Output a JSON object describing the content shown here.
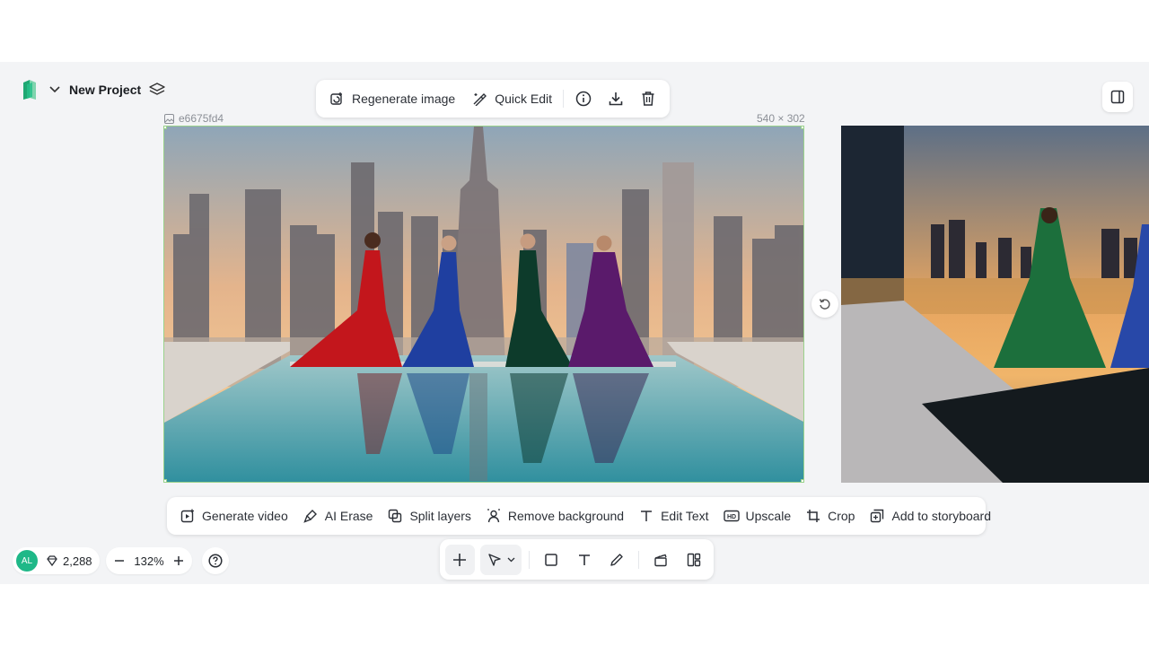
{
  "header": {
    "project_title": "New Project"
  },
  "image_toolbar": {
    "regenerate_label": "Regenerate image",
    "quick_edit_label": "Quick Edit"
  },
  "canvas": {
    "image_id": "e6675fd4",
    "image_size": "540 × 302"
  },
  "action_bar": {
    "items": [
      {
        "label": "Generate video",
        "icon": "video-plus-icon"
      },
      {
        "label": "AI Erase",
        "icon": "brush-icon"
      },
      {
        "label": "Split layers",
        "icon": "layers-split-icon"
      },
      {
        "label": "Remove background",
        "icon": "person-cutout-icon"
      },
      {
        "label": "Edit Text",
        "icon": "text-icon"
      },
      {
        "label": "Upscale",
        "icon": "hd-icon"
      },
      {
        "label": "Crop",
        "icon": "crop-icon"
      },
      {
        "label": "Add to storyboard",
        "icon": "storyboard-icon"
      }
    ]
  },
  "status": {
    "avatar_initials": "AL",
    "credits": "2,288",
    "zoom": "132%"
  },
  "colors": {
    "accent_green": "#1fb888",
    "selection_border": "#9ad28b",
    "canvas_bg": "#f3f4f6"
  }
}
